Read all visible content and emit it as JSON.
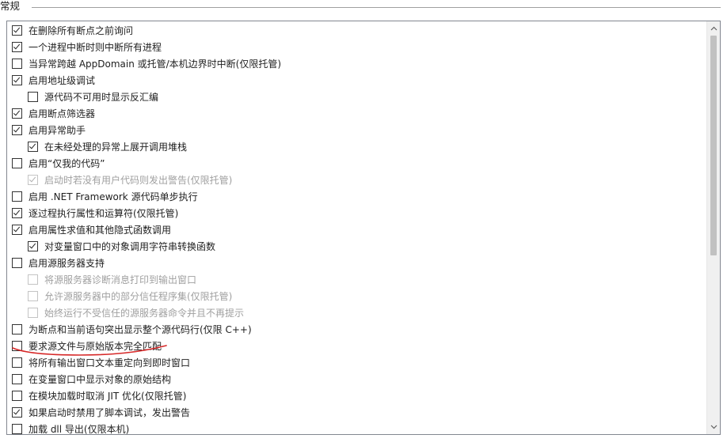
{
  "group": {
    "title": "常规"
  },
  "options": [
    {
      "label": "在删除所有断点之前询问",
      "checked": true,
      "disabled": false,
      "indent": 0
    },
    {
      "label": "一个进程中断时则中断所有进程",
      "checked": true,
      "disabled": false,
      "indent": 0
    },
    {
      "label": "当异常跨越 AppDomain 或托管/本机边界时中断(仅限托管)",
      "checked": false,
      "disabled": false,
      "indent": 0
    },
    {
      "label": "启用地址级调试",
      "checked": true,
      "disabled": false,
      "indent": 0
    },
    {
      "label": "源代码不可用时显示反汇编",
      "checked": false,
      "disabled": false,
      "indent": 1
    },
    {
      "label": "启用断点筛选器",
      "checked": true,
      "disabled": false,
      "indent": 0
    },
    {
      "label": "启用异常助手",
      "checked": true,
      "disabled": false,
      "indent": 0
    },
    {
      "label": "在未经处理的异常上展开调用堆栈",
      "checked": true,
      "disabled": false,
      "indent": 1
    },
    {
      "label": "启用“仅我的代码”",
      "checked": false,
      "disabled": false,
      "indent": 0
    },
    {
      "label": "启动时若没有用户代码则发出警告(仅限托管)",
      "checked": true,
      "disabled": true,
      "indent": 1
    },
    {
      "label": "启用 .NET Framework 源代码单步执行",
      "checked": false,
      "disabled": false,
      "indent": 0
    },
    {
      "label": "逐过程执行属性和运算符(仅限托管)",
      "checked": true,
      "disabled": false,
      "indent": 0
    },
    {
      "label": "启用属性求值和其他隐式函数调用",
      "checked": true,
      "disabled": false,
      "indent": 0
    },
    {
      "label": "对变量窗口中的对象调用字符串转换函数",
      "checked": true,
      "disabled": false,
      "indent": 1
    },
    {
      "label": "启用源服务器支持",
      "checked": false,
      "disabled": false,
      "indent": 0
    },
    {
      "label": "将源服务器诊断消息打印到输出窗口",
      "checked": false,
      "disabled": true,
      "indent": 1
    },
    {
      "label": "允许源服务器中的部分信任程序集(仅限托管)",
      "checked": false,
      "disabled": true,
      "indent": 1
    },
    {
      "label": "始终运行不受信任的源服务器命令并且不再提示",
      "checked": false,
      "disabled": true,
      "indent": 1
    },
    {
      "label": "为断点和当前语句突出显示整个源代码行(仅限 C++)",
      "checked": false,
      "disabled": false,
      "indent": 0
    },
    {
      "label": "要求源文件与原始版本完全匹配",
      "checked": false,
      "disabled": false,
      "indent": 0
    },
    {
      "label": "将所有输出窗口文本重定向到即时窗口",
      "checked": false,
      "disabled": false,
      "indent": 0
    },
    {
      "label": "在变量窗口中显示对象的原始结构",
      "checked": false,
      "disabled": false,
      "indent": 0
    },
    {
      "label": "在模块加载时取消 JIT 优化(仅限托管)",
      "checked": false,
      "disabled": false,
      "indent": 0
    },
    {
      "label": "如果启动时禁用了脚本调试，发出警告",
      "checked": true,
      "disabled": false,
      "indent": 0
    },
    {
      "label": "加载 dll 导出(仅限本机)",
      "checked": false,
      "disabled": false,
      "indent": 0
    }
  ],
  "icons": {
    "scroll_up": "chevron-up-icon",
    "scroll_down": "chevron-down-icon"
  },
  "colors": {
    "annotation_underline": "#d62828"
  }
}
